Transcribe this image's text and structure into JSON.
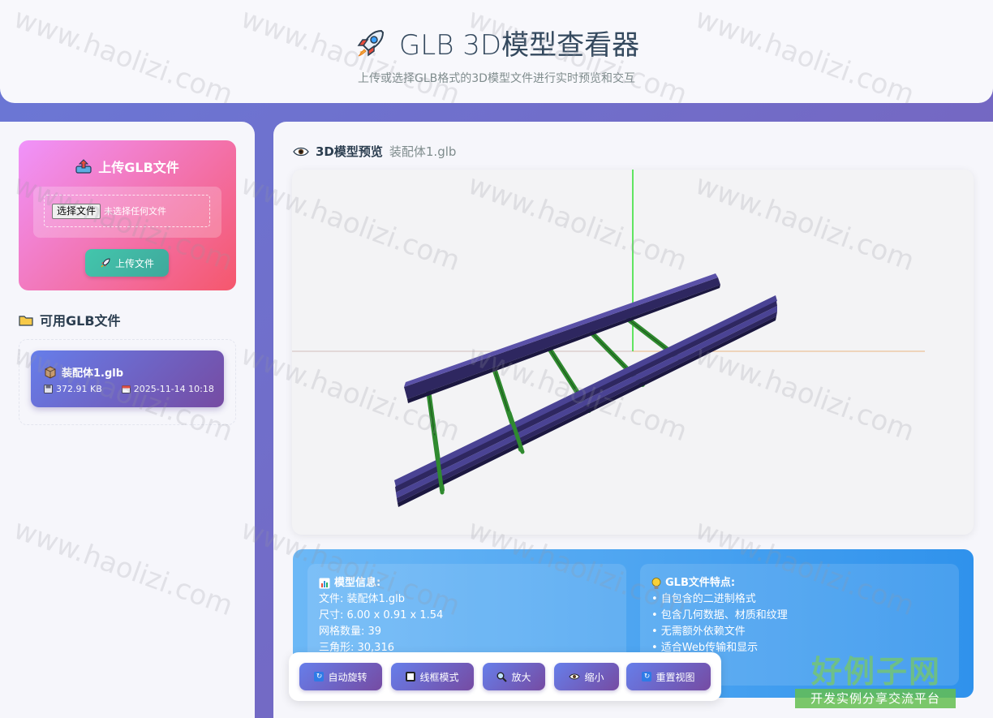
{
  "header": {
    "title": "GLB 3D模型查看器",
    "subtitle": "上传或选择GLB格式的3D模型文件进行实时预览和交互"
  },
  "upload": {
    "title": "上传GLB文件",
    "choose_button": "选择文件",
    "no_file_text": "未选择任何文件",
    "submit_label": "上传文件"
  },
  "files": {
    "heading": "可用GLB文件",
    "items": [
      {
        "name": "装配体1.glb",
        "size": "372.91 KB",
        "date": "2025-11-14 10:18"
      }
    ]
  },
  "preview": {
    "heading": "3D模型预览",
    "filename": "装配体1.glb"
  },
  "model_info": {
    "title": "模型信息:",
    "file": "文件: 装配体1.glb",
    "size": "尺寸: 6.00 x 0.91 x 1.54",
    "mesh_count": "网格数量: 39",
    "triangles": "三角形: 30,316"
  },
  "glb_features": {
    "title": "GLB文件特点:",
    "items": [
      "• 自包含的二进制格式",
      "• 包含几何数据、材质和纹理",
      "• 无需额外依赖文件",
      "• 适合Web传输和显示"
    ]
  },
  "controls": {
    "auto_rotate": "自动旋转",
    "wireframe": "线框模式",
    "zoom_in": "放大",
    "zoom_out": "缩小",
    "reset_view": "重置视图"
  },
  "watermark": {
    "text": "www.haolizi.com",
    "badge_title": "好例子网",
    "badge_sub": "开发实例分享交流平台"
  },
  "colors": {
    "background_gradient_start": "#6a78d6",
    "background_gradient_end": "#7a5fb8",
    "upload_card_start": "#f093fb",
    "upload_card_end": "#f5576c",
    "button_start": "#667eea",
    "button_end": "#764ba2",
    "info_start": "#6cb8f6",
    "info_end": "#2f92ec",
    "beam": "#3b3470",
    "strut": "#2e8b2e"
  }
}
